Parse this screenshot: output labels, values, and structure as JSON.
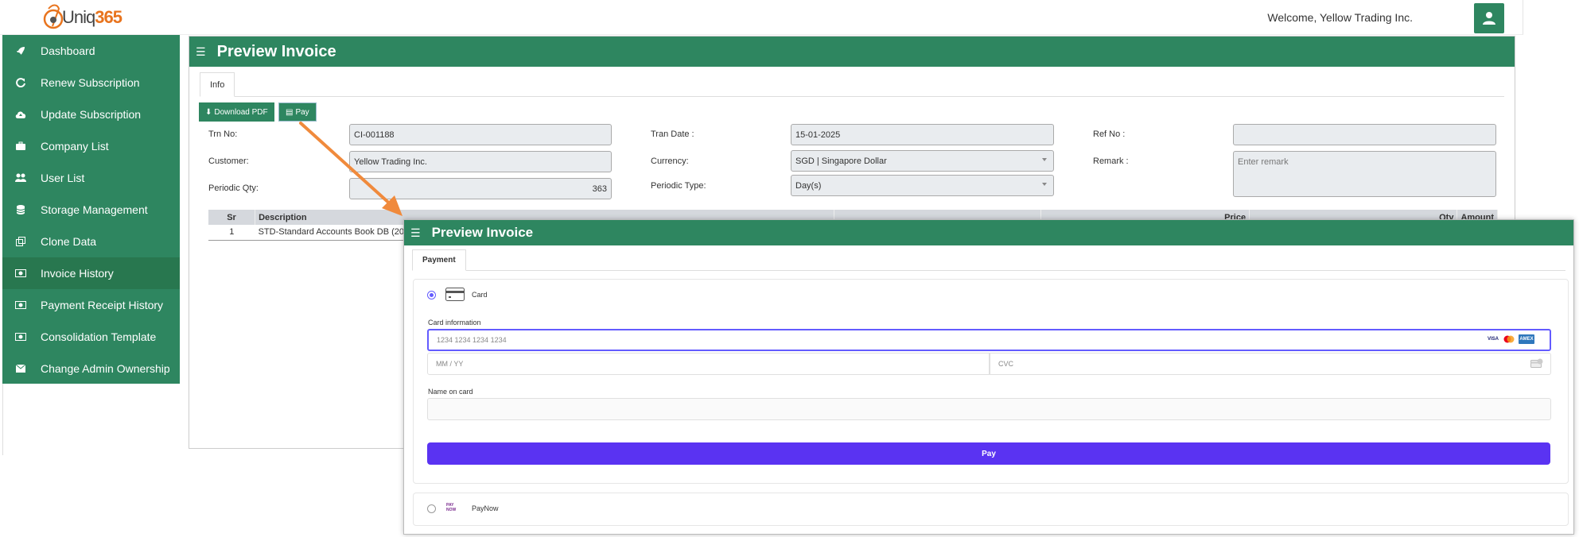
{
  "header": {
    "logo_text_a": "Uniq",
    "logo_text_b": "365",
    "welcome": "Welcome, Yellow Trading Inc."
  },
  "sidebar": {
    "items": [
      {
        "label": "Dashboard",
        "icon": "rocket-icon"
      },
      {
        "label": "Renew Subscription",
        "icon": "refresh-icon"
      },
      {
        "label": "Update Subscription",
        "icon": "cloud-upload-icon"
      },
      {
        "label": "Company List",
        "icon": "briefcase-icon"
      },
      {
        "label": "User List",
        "icon": "users-icon"
      },
      {
        "label": "Storage Management",
        "icon": "database-icon"
      },
      {
        "label": "Clone Data",
        "icon": "clone-icon"
      },
      {
        "label": "Invoice History",
        "icon": "money-icon"
      },
      {
        "label": "Payment Receipt History",
        "icon": "money-icon"
      },
      {
        "label": "Consolidation Template",
        "icon": "money-icon"
      },
      {
        "label": "Change Admin Ownership",
        "icon": "envelope-icon"
      }
    ],
    "active_index": 7
  },
  "main": {
    "title": "Preview Invoice",
    "tab": "Info",
    "download_label": "Download PDF",
    "pay_label": "Pay",
    "fields": {
      "trn_no_label": "Trn No:",
      "trn_no": "CI-001188",
      "customer_label": "Customer:",
      "customer": "Yellow Trading Inc.",
      "periodic_qty_label": "Periodic Qty:",
      "periodic_qty": "363",
      "tran_date_label": "Tran Date :",
      "tran_date": "15-01-2025",
      "currency_label": "Currency:",
      "currency": "SGD | Singapore Dollar",
      "periodic_type_label": "Periodic Type:",
      "periodic_type": "Day(s)",
      "ref_no_label": "Ref No :",
      "ref_no": "",
      "remark_label": "Remark :",
      "remark_placeholder": "Enter remark"
    },
    "table": {
      "headers": [
        "Sr",
        "Description",
        "",
        "Price",
        "Qty",
        "Amount"
      ],
      "rows": [
        [
          "1",
          "STD-Standard Accounts Book DB (20"
        ]
      ]
    }
  },
  "modal": {
    "title": "Preview Invoice",
    "tab": "Payment",
    "card_label": "Card",
    "card_info_label": "Card information",
    "card_number_placeholder": "1234 1234 1234 1234",
    "card_brands": [
      "VISA",
      "MC",
      "AMEX"
    ],
    "expiry_placeholder": "MM / YY",
    "cvc_placeholder": "CVC",
    "name_label": "Name on card",
    "name_value": "",
    "pay_button": "Pay",
    "paynow_label": "PayNow",
    "paynow_logo": "PAY NOW"
  },
  "colors": {
    "brand_green": "#2e8660",
    "stripe_purple": "#5a33f2",
    "arrow_orange": "#f08a3c"
  }
}
